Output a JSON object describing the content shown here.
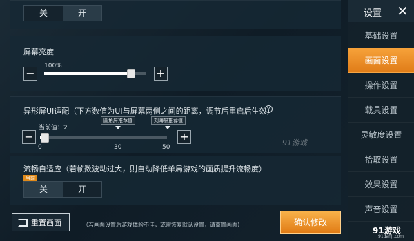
{
  "top_toggle": {
    "off": "关",
    "on": "开"
  },
  "brightness": {
    "label": "屏幕亮度",
    "value_text": "100%",
    "level_fraction": 0.85
  },
  "ui_adapt": {
    "label": "异形屏UI适配（下方数值为UI与屏幕两侧之间的距离，调节后重启后生效）",
    "current": "当前值：2",
    "tag_round": "圆角屏推荐值",
    "tag_notch": "刘海屏推荐值",
    "ticks": [
      "0",
      "30",
      "50"
    ],
    "level_fraction": 0.04
  },
  "smooth": {
    "label": "流畅自适应（若帧数波动过大，则自动降低单局游戏的画质提升流畅度）",
    "badge": "当前",
    "off": "关",
    "on": "开"
  },
  "sidebar": {
    "title": "设置",
    "items": [
      "基础设置",
      "画面设置",
      "操作设置",
      "载具设置",
      "灵敏度设置",
      "拾取设置",
      "效果设置",
      "声音设置"
    ]
  },
  "footer": {
    "reset": "重置画面",
    "note": "（若画面设置后游戏体验不佳，或需恢复默认设置，请重置画面）",
    "confirm": "确认修改"
  },
  "watermark": "91游戏",
  "logo": {
    "name": "91游戏",
    "url": "91danji.com"
  },
  "colors": {
    "accent": "#f29a2e",
    "panel": "#162834"
  }
}
